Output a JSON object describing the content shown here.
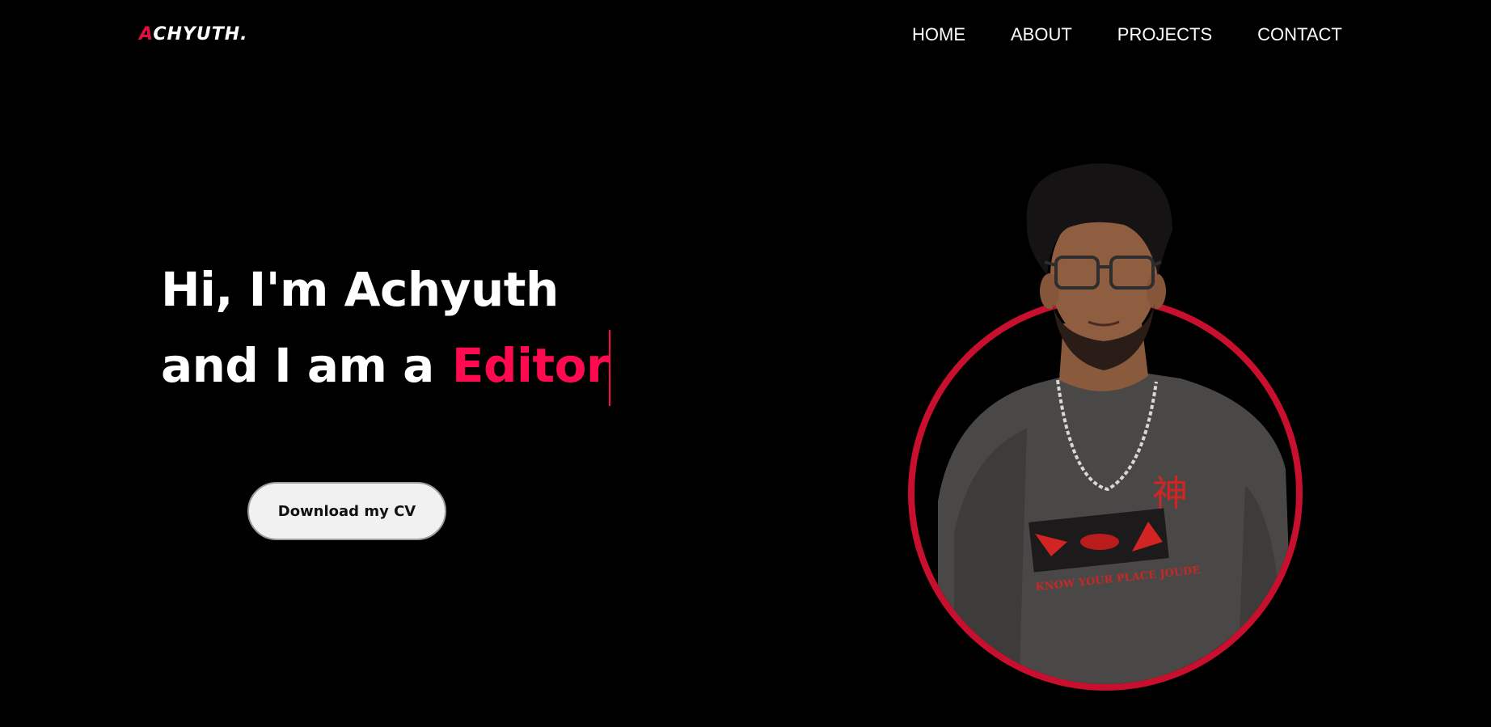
{
  "brand": {
    "logo_first": "A",
    "logo_rest": "CHYUTH."
  },
  "nav": {
    "items": [
      "HOME",
      "ABOUT",
      "PROJECTS",
      "CONTACT"
    ]
  },
  "hero": {
    "greeting": "Hi, I'm Achyuth",
    "intro": "and I am a",
    "role": "Editor",
    "cta_label": "Download my CV"
  },
  "portrait": {
    "shirt_text": "KNOW YOUR PLACE JOUDE",
    "shirt_kanji": "神"
  },
  "colors": {
    "background": "#000000",
    "accent": "#ff0a50",
    "ring": "#c8102e",
    "text": "#ffffff"
  }
}
